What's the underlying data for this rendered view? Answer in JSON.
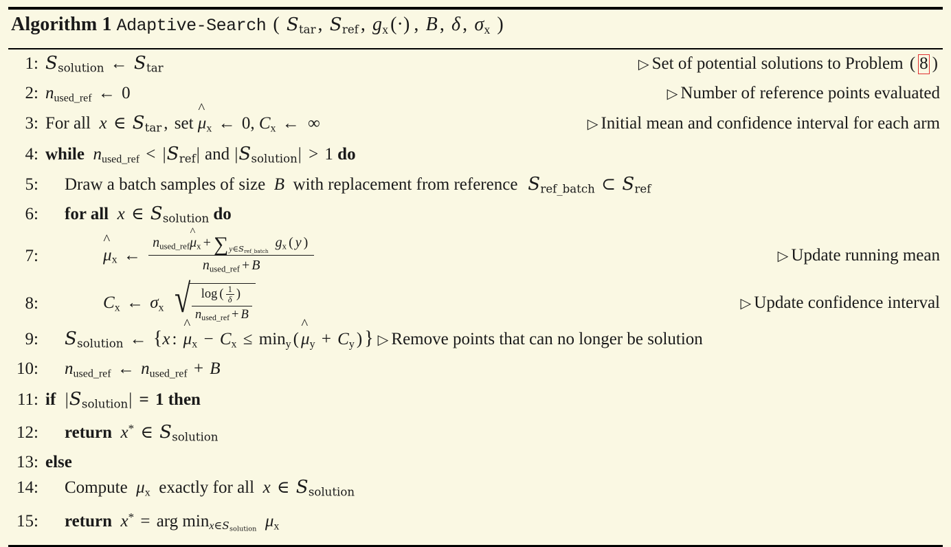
{
  "document": {
    "kind": "algorithm-pseudocode-float",
    "background_color": "#faf8e3",
    "text_color": "#1a1a1a",
    "link_box_color": "#e03030"
  },
  "title": {
    "label": "Algorithm",
    "number": "1",
    "procedure_name": "Adaptive-Search",
    "open_paren": "(",
    "close_paren": ")",
    "args": [
      {
        "base": "S",
        "sub": "tar",
        "sep": ","
      },
      {
        "base": "S",
        "sub": "ref",
        "sep": ","
      },
      {
        "base": "g",
        "sub": "x",
        "extra": "(·)",
        "sep": ","
      },
      {
        "base": "B",
        "sub": "",
        "sep": ","
      },
      {
        "base": "δ",
        "sub": "",
        "sep": ","
      },
      {
        "base": "σ",
        "sub": "x",
        "sep": ""
      }
    ]
  },
  "lines": [
    {
      "n": "1:",
      "indent": 0,
      "comment": "Set of potential solutions to Problem",
      "comment_ref": "8",
      "code_plain": "S_solution ← S_tar"
    },
    {
      "n": "2:",
      "indent": 0,
      "comment": "Number of reference points evaluated",
      "code_plain": "n_used_ref ← 0"
    },
    {
      "n": "3:",
      "indent": 0,
      "comment": "Initial mean and confidence interval for each arm",
      "code_plain": "For all x ∈ S_tar, set μ̂_x ← 0, C_x ← ∞",
      "words": {
        "for_all": "For all",
        "set": "set"
      }
    },
    {
      "n": "4:",
      "indent": 0,
      "comment": "",
      "code_plain": "while n_used_ref < |S_ref| and |S_solution| > 1 do",
      "words": {
        "while": "while",
        "and": "and",
        "do": "do"
      }
    },
    {
      "n": "5:",
      "indent": 1,
      "comment": "",
      "code_plain": "Draw a batch samples of size B with replacement from reference S_ref_batch ⊂ S_ref",
      "words": {
        "t1": "Draw a batch samples of size",
        "t2": "with replacement from reference"
      }
    },
    {
      "n": "6:",
      "indent": 1,
      "comment": "",
      "code_plain": "for all x ∈ S_solution do",
      "words": {
        "for_all": "for all",
        "do": "do"
      }
    },
    {
      "n": "7:",
      "indent": 3,
      "comment": "Update running mean",
      "code_plain": "μ̂_x ← ( n_used_ref μ̂_x + Σ_{y∈S_ref_batch} g_x(y) ) / ( n_used_ref + B )"
    },
    {
      "n": "8:",
      "indent": 3,
      "comment": "Update confidence interval",
      "code_plain": "C_x ← σ_x √( log(1/δ) / (n_used_ref + B) )"
    },
    {
      "n": "9:",
      "indent": 1,
      "comment": "Remove points that can no longer be solution",
      "comment_inline": true,
      "code_plain": "S_solution ← { x : μ̂_x − C_x ≤ min_y(μ̂_y + C_y) }"
    },
    {
      "n": "10:",
      "indent": 1,
      "comment": "",
      "code_plain": "n_used_ref ← n_used_ref + B"
    },
    {
      "n": "11:",
      "indent": 0,
      "comment": "",
      "code_plain": "if |S_solution| = 1 then",
      "words": {
        "if": "if",
        "then": "then"
      }
    },
    {
      "n": "12:",
      "indent": 1,
      "comment": "",
      "code_plain": "return x* ∈ S_solution",
      "words": {
        "return": "return"
      }
    },
    {
      "n": "13:",
      "indent": 0,
      "comment": "",
      "code_plain": "else",
      "words": {
        "else": "else"
      }
    },
    {
      "n": "14:",
      "indent": 1,
      "comment": "",
      "code_plain": "Compute μ_x exactly for all x ∈ S_solution",
      "words": {
        "t1": "Compute",
        "t2": "exactly for all"
      }
    },
    {
      "n": "15:",
      "indent": 1,
      "comment": "",
      "code_plain": "return x* = arg min_{x∈S_solution} μ_x",
      "words": {
        "return": "return",
        "argmin": "arg min"
      }
    }
  ],
  "symbols": {
    "assign": "←",
    "in": "∈",
    "subset": "⊂",
    "infinity": "∞",
    "leq": "≤",
    "lt": "<",
    "gt": ">",
    "eq": "=",
    "plus": "+",
    "minus": "−",
    "sum": "∑",
    "triangle": "▷",
    "sigma": "σ",
    "mu": "μ",
    "delta": "δ",
    "log": "log",
    "min": "min",
    "radical": "√",
    "cdot": "·",
    "zero": "0",
    "one": "1",
    "B": "B",
    "C": "C",
    "S": "S",
    "n": "n",
    "x": "x",
    "y": "y",
    "g": "g",
    "star": "*"
  }
}
